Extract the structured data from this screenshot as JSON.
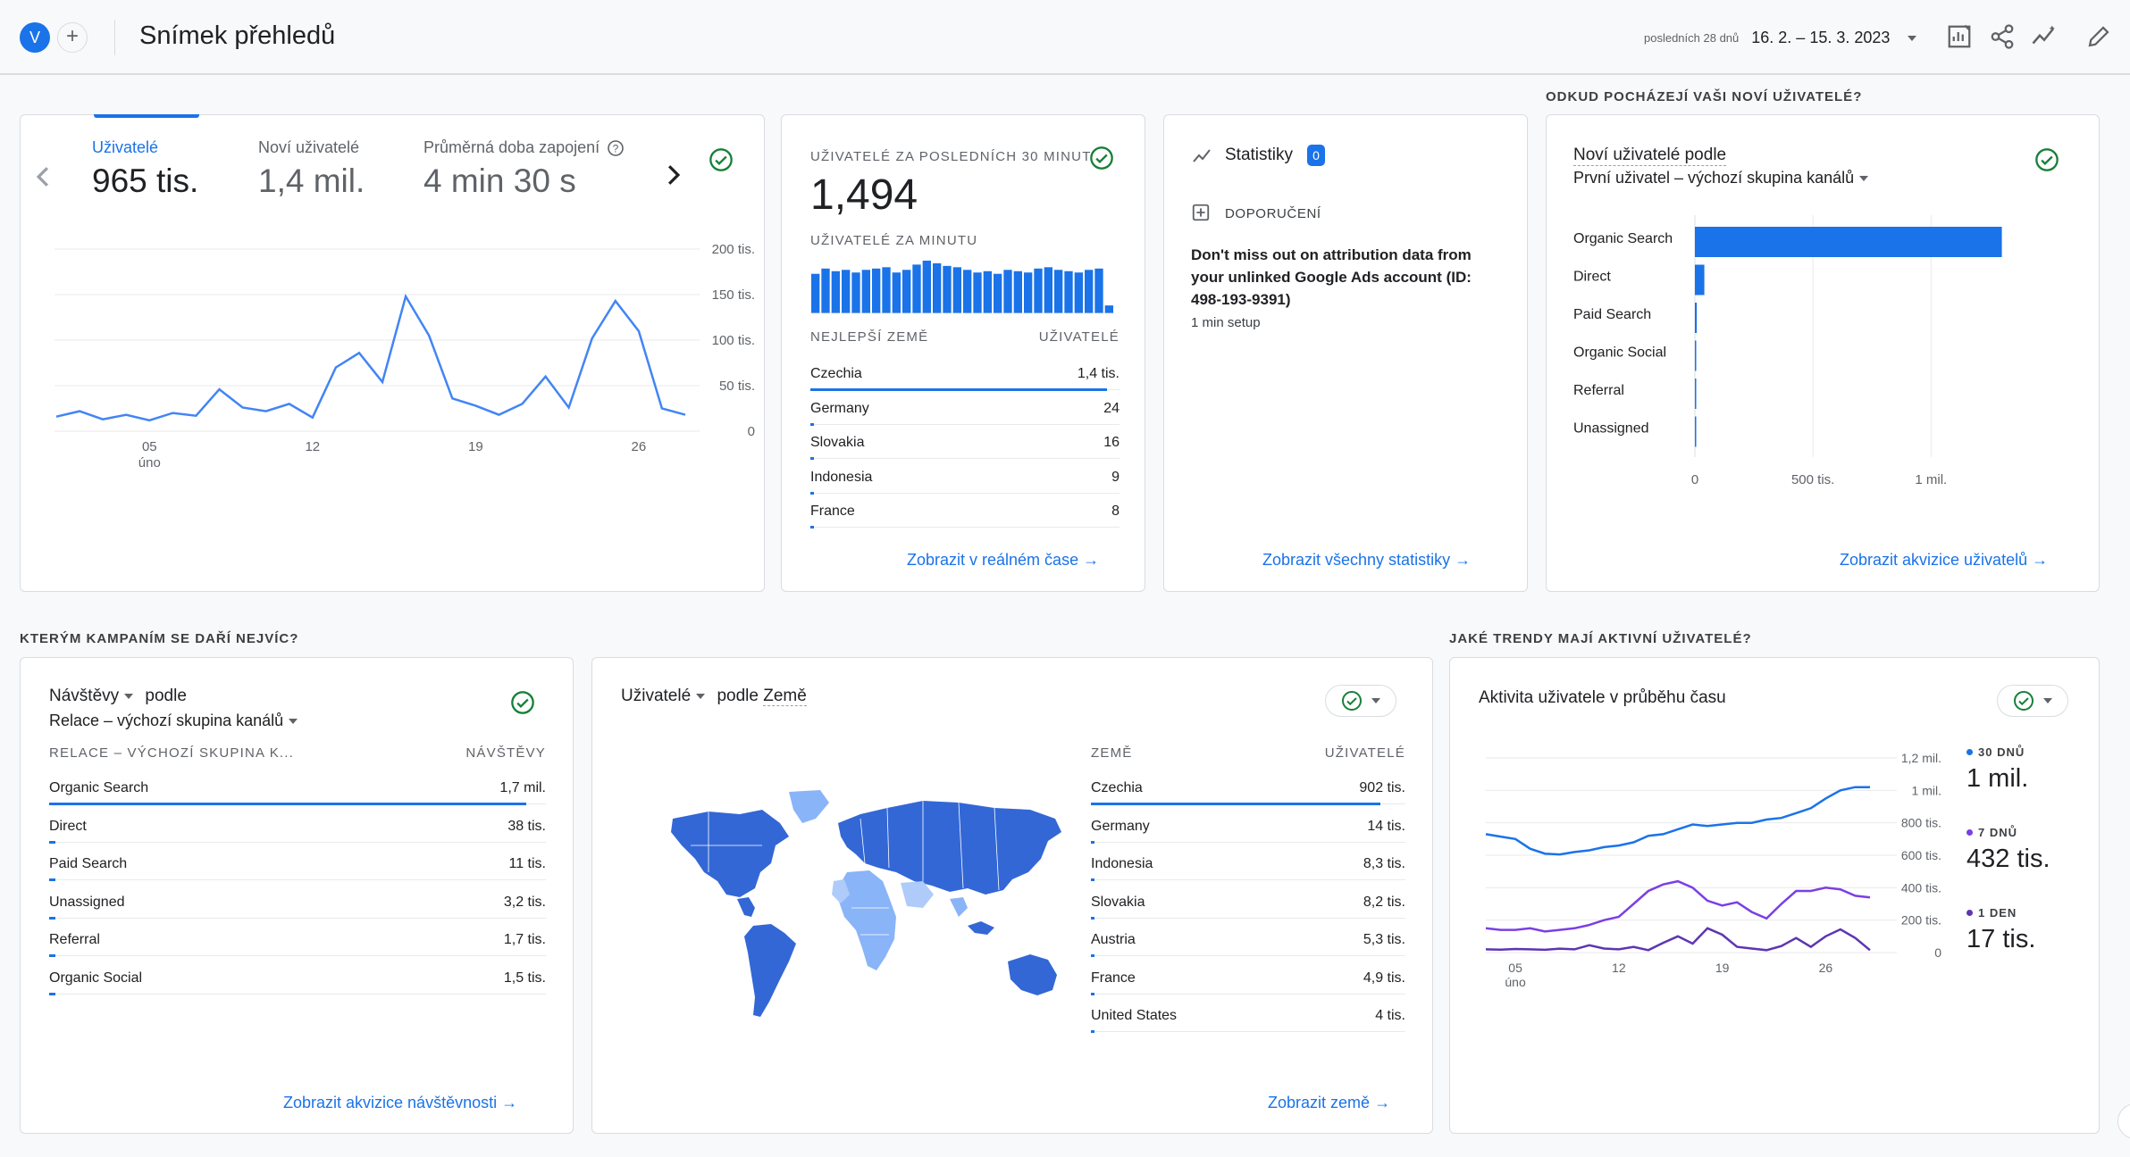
{
  "header": {
    "avatar": "V",
    "title": "Snímek přehledů",
    "range_label": "posledních 28 dnů",
    "range_value": "16. 2. – 15. 3. 2023"
  },
  "users_card": {
    "metrics": [
      {
        "label": "Uživatelé",
        "value": "965 tis."
      },
      {
        "label": "Noví uživatelé",
        "value": "1,4 mil."
      },
      {
        "label": "Průměrná doba zapojení",
        "value": "4 min 30 s"
      }
    ],
    "y_ticks": [
      "200 tis.",
      "150 tis.",
      "100 tis.",
      "50 tis.",
      "0"
    ],
    "x_ticks": [
      "05",
      "12",
      "19",
      "26"
    ],
    "x_sub": "úno"
  },
  "realtime": {
    "title": "UŽIVATELÉ ZA POSLEDNÍCH 30 MINUT",
    "value": "1,494",
    "per_minute": "UŽIVATELÉ ZA MINUTU",
    "col1": "NEJLEPŠÍ ZEMĚ",
    "col2": "UŽIVATELÉ",
    "rows": [
      {
        "name": "Czechia",
        "value": "1,4 tis."
      },
      {
        "name": "Germany",
        "value": "24"
      },
      {
        "name": "Slovakia",
        "value": "16"
      },
      {
        "name": "Indonesia",
        "value": "9"
      },
      {
        "name": "France",
        "value": "8"
      }
    ],
    "link": "Zobrazit v reálném čase"
  },
  "insights": {
    "title": "Statistiky",
    "badge": "0",
    "rec_label": "DOPORUČENÍ",
    "rec_text": "Don't miss out on attribution data from your unlinked Google Ads account (ID: 498-193-9391)",
    "rec_sub": "1 min setup",
    "link": "Zobrazit všechny statistiky"
  },
  "new_users": {
    "section": "ODKUD POCHÁZEJÍ VAŠI NOVÍ UŽIVATELÉ?",
    "title": "Noví uživatelé podle",
    "dimension": "První uživatel – výchozí skupina kanálů",
    "categories": [
      "Organic Search",
      "Direct",
      "Paid Search",
      "Organic Social",
      "Referral",
      "Unassigned"
    ],
    "x_ticks": [
      "0",
      "500 tis.",
      "1 mil."
    ],
    "link": "Zobrazit akvizice uživatelů"
  },
  "campaigns": {
    "section": "KTERÝM KAMPANÍM SE DAŘÍ NEJVÍC?",
    "metric": "Návštěvy",
    "by": "podle",
    "dimension": "Relace – výchozí skupina kanálů",
    "col1": "RELACE – VÝCHOZÍ SKUPINA K...",
    "col2": "NÁVŠTĚVY",
    "rows": [
      {
        "name": "Organic Search",
        "value": "1,7 mil."
      },
      {
        "name": "Direct",
        "value": "38 tis."
      },
      {
        "name": "Paid Search",
        "value": "11 tis."
      },
      {
        "name": "Unassigned",
        "value": "3,2 tis."
      },
      {
        "name": "Referral",
        "value": "1,7 tis."
      },
      {
        "name": "Organic Social",
        "value": "1,5 tis."
      }
    ],
    "link": "Zobrazit akvizice návštěvnosti"
  },
  "countries": {
    "metric": "Uživatelé",
    "by": "podle",
    "dimension": "Země",
    "col1": "ZEMĚ",
    "col2": "UŽIVATELÉ",
    "rows": [
      {
        "name": "Czechia",
        "value": "902 tis."
      },
      {
        "name": "Germany",
        "value": "14 tis."
      },
      {
        "name": "Indonesia",
        "value": "8,3 tis."
      },
      {
        "name": "Slovakia",
        "value": "8,2 tis."
      },
      {
        "name": "Austria",
        "value": "5,3 tis."
      },
      {
        "name": "France",
        "value": "4,9 tis."
      },
      {
        "name": "United States",
        "value": "4 tis."
      }
    ],
    "link": "Zobrazit země"
  },
  "trends": {
    "section": "JAKÉ TRENDY MAJÍ AKTIVNÍ UŽIVATELÉ?",
    "title": "Aktivita uživatele v průběhu času",
    "y_ticks": [
      "1,2 mil.",
      "1 mil.",
      "800 tis.",
      "600 tis.",
      "400 tis.",
      "200 tis.",
      "0"
    ],
    "x_ticks": [
      "05",
      "12",
      "19",
      "26"
    ],
    "x_sub": "úno",
    "legend": [
      {
        "label": "30 DNŮ",
        "value": "1 mil.",
        "color": "#1a73e8"
      },
      {
        "label": "7 DNŮ",
        "value": "432 tis.",
        "color": "#7b3fe4"
      },
      {
        "label": "1 DEN",
        "value": "17 tis.",
        "color": "#5e35b1"
      }
    ]
  },
  "chart_data": [
    {
      "type": "line",
      "x": [
        "16.2.",
        "17.2.",
        "18.2.",
        "19.2.",
        "20.2.",
        "21.2.",
        "22.2.",
        "23.2.",
        "24.2.",
        "25.2.",
        "26.2.",
        "27.2.",
        "28.2.",
        "1.3.",
        "2.3.",
        "3.3.",
        "4.3.",
        "5.3.",
        "6.3.",
        "7.3.",
        "8.3.",
        "9.3.",
        "10.3.",
        "11.3.",
        "12.3.",
        "13.3.",
        "14.3.",
        "15.3."
      ],
      "series": [
        {
          "values": [
            16,
            22,
            13,
            18,
            12,
            20,
            17,
            46,
            26,
            22,
            30,
            15,
            70,
            86,
            54,
            148,
            105,
            36,
            28,
            18,
            30,
            60,
            26,
            102,
            143,
            110,
            25,
            18
          ]
        }
      ],
      "ylim": [
        0,
        200
      ],
      "y_ticks": [
        "200 tis.",
        "150 tis.",
        "100 tis.",
        "50 tis.",
        "0"
      ],
      "x_ticks": [
        "05",
        "12",
        "19",
        "26"
      ]
    },
    {
      "type": "bar",
      "values": [
        30,
        34,
        32,
        33,
        31,
        33,
        34,
        35,
        31,
        33,
        37,
        40,
        38,
        36,
        35,
        33,
        31,
        32,
        30,
        33,
        32,
        31,
        34,
        35,
        33,
        32,
        31,
        33,
        34,
        6
      ],
      "title": "UŽIVATELÉ ZA MINUTU"
    },
    {
      "type": "bar",
      "categories": [
        "Organic Search",
        "Direct",
        "Paid Search",
        "Organic Social",
        "Referral",
        "Unassigned"
      ],
      "values": [
        1300000,
        40000,
        8000,
        1500,
        1200,
        800
      ],
      "xlim": [
        0,
        1400000
      ],
      "x_ticks": [
        "0",
        "500 tis.",
        "1 mil."
      ]
    },
    {
      "type": "line",
      "x_ticks": [
        "05",
        "12",
        "19",
        "26"
      ],
      "ylim": [
        0,
        1200000
      ],
      "y_ticks": [
        "1,2 mil.",
        "1 mil.",
        "800 tis.",
        "600 tis.",
        "400 tis.",
        "200 tis.",
        "0"
      ],
      "series": [
        {
          "name": "30 DNŮ",
          "values": [
            730,
            715,
            700,
            640,
            610,
            605,
            620,
            630,
            650,
            660,
            680,
            720,
            730,
            760,
            790,
            780,
            790,
            800,
            800,
            820,
            830,
            860,
            890,
            950,
            1000,
            1020,
            1020
          ]
        },
        {
          "name": "7 DNŮ",
          "values": [
            150,
            140,
            140,
            150,
            130,
            140,
            150,
            170,
            200,
            220,
            300,
            380,
            420,
            440,
            400,
            320,
            290,
            310,
            250,
            210,
            300,
            380,
            380,
            400,
            390,
            350,
            340
          ]
        },
        {
          "name": "1 DEN",
          "values": [
            20,
            18,
            22,
            20,
            17,
            24,
            20,
            45,
            25,
            20,
            35,
            15,
            60,
            100,
            55,
            150,
            110,
            35,
            25,
            15,
            40,
            90,
            35,
            100,
            143,
            90,
            15
          ]
        }
      ]
    }
  ]
}
